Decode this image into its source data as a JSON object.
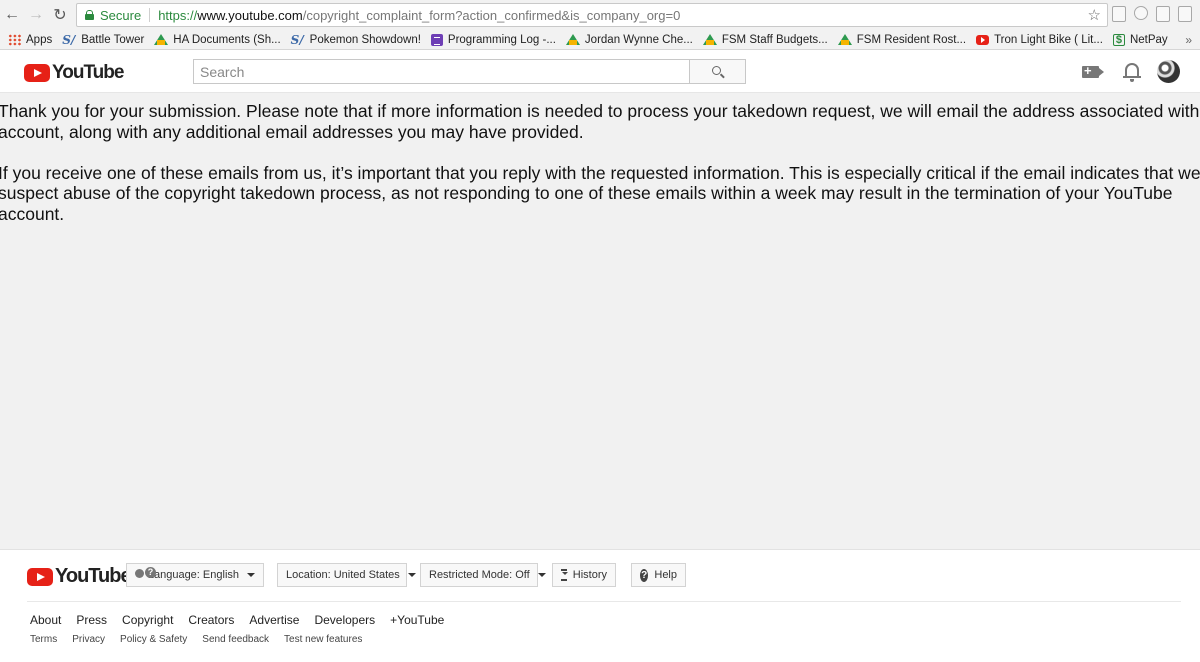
{
  "browser": {
    "secure_label": "Secure",
    "url_scheme": "https://",
    "url_host": "www.youtube.com",
    "url_path": "/copyright_complaint_form?action_confirmed&is_company_org=0"
  },
  "bookmarks": [
    {
      "label": "Apps",
      "icon": "apps-icon"
    },
    {
      "label": "Battle Tower",
      "icon": "smogon-icon"
    },
    {
      "label": "HA Documents (Sh...",
      "icon": "google-drive-icon"
    },
    {
      "label": "Pokemon Showdown!",
      "icon": "smogon-icon"
    },
    {
      "label": "Programming Log -...",
      "icon": "google-forms-icon"
    },
    {
      "label": "Jordan Wynne Che...",
      "icon": "google-drive-icon"
    },
    {
      "label": "FSM Staff Budgets...",
      "icon": "google-drive-icon"
    },
    {
      "label": "FSM Resident Rost...",
      "icon": "google-drive-icon"
    },
    {
      "label": "Tron Light Bike ( Lit...",
      "icon": "youtube-icon"
    },
    {
      "label": "NetPay",
      "icon": "netpay-icon"
    }
  ],
  "masthead": {
    "logo_text": "YouTube",
    "search_placeholder": "Search"
  },
  "message": {
    "line1": "Thank you for your submission. Please note that if more information is needed to process your takedown request, we will email the address associated with you",
    "line2": "account, along with any additional email addresses you may have provided.",
    "line3": "If you receive one of these emails from us, it’s important that you reply with the requested information. This is especially critical if the email indicates that we",
    "line4": "suspect abuse of the copyright takedown process, as not responding to one of these emails within a week may result in the termination of your YouTube",
    "line5": "account."
  },
  "footer": {
    "logo_text": "YouTube",
    "language_label": "Language:",
    "language_value": "English",
    "location_label": "Location:",
    "location_value": "United States",
    "restricted_label": "Restricted Mode:",
    "restricted_value": "Off",
    "history_label": "History",
    "help_label": "Help",
    "primary_links": [
      "About",
      "Press",
      "Copyright",
      "Creators",
      "Advertise",
      "Developers",
      "+YouTube"
    ],
    "secondary_links": [
      "Terms",
      "Privacy",
      "Policy & Safety",
      "Send feedback",
      "Test new features"
    ]
  }
}
